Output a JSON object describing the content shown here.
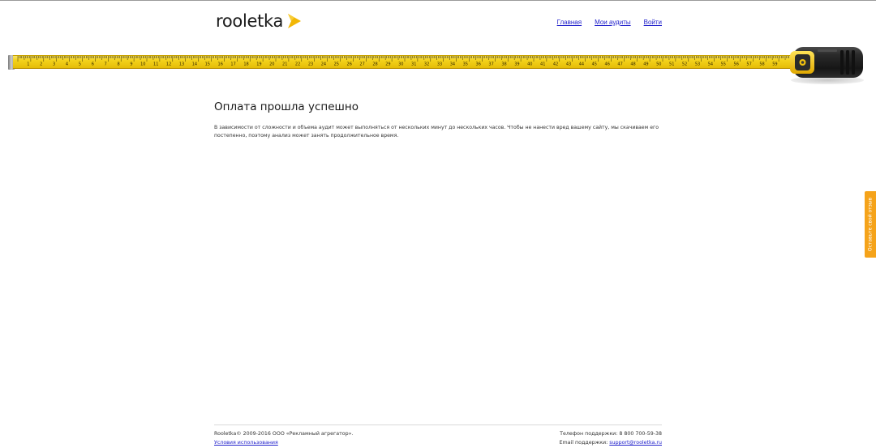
{
  "brand": {
    "logo_text": "rooletka",
    "accent_color": "#f2b705"
  },
  "nav": {
    "items": [
      {
        "label": "Главная"
      },
      {
        "label": "Мои аудиты"
      },
      {
        "label": "Войти"
      }
    ]
  },
  "tape": {
    "marks": [
      1,
      2,
      3,
      4,
      5,
      6,
      7,
      8,
      9,
      10,
      11,
      12,
      13,
      14,
      15,
      16,
      17,
      18,
      19,
      20,
      21,
      22,
      23,
      24,
      25,
      26,
      27,
      28,
      29,
      30,
      31,
      32,
      33,
      34,
      35,
      36,
      37,
      38,
      39,
      40,
      41,
      42,
      43,
      44,
      45,
      46,
      47,
      48,
      49,
      50,
      51,
      52,
      53,
      54,
      55,
      56,
      57,
      58,
      59,
      60
    ]
  },
  "main": {
    "title": "Оплата прошла успешно",
    "text": "В зависимости от сложности и объема аудит может выполняться от нескольких минут до нескольких часов. Чтобы не нанести вред вашему сайту, мы скачиваем его постепенно, поэтому анализ может занять продолжительное время."
  },
  "feedback": {
    "label": "Оставьте свой отзыв",
    "color": "#f5a31a"
  },
  "footer": {
    "copyright": "Rooletka© 2009-2016 ООО «Рекламный агрегатор».",
    "terms_link": "Условия использования",
    "phone_label": "Телефон поддержки: 8 800 700-59-38",
    "email_label": "Email поддержки:",
    "email_link": "support@rooletka.ru"
  }
}
